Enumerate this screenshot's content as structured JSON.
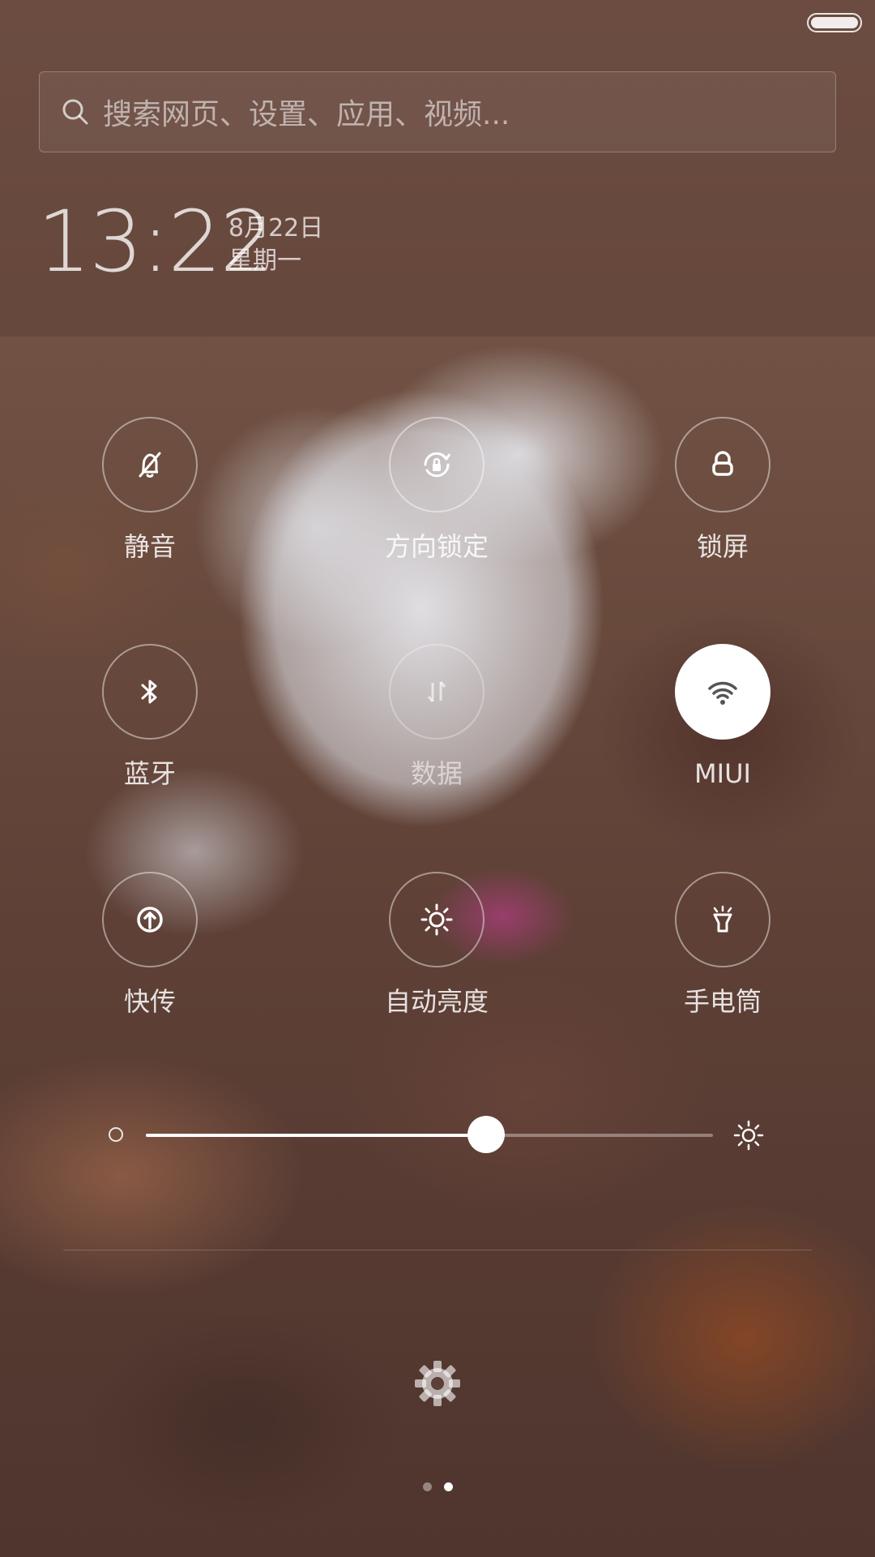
{
  "status_bar": {
    "battery_icon": "battery-full-icon"
  },
  "search": {
    "placeholder": "搜索网页、设置、应用、视频...",
    "icon": "search-icon"
  },
  "clock": {
    "time": "13:22",
    "date": "8月22日",
    "weekday": "星期一"
  },
  "toggles": [
    {
      "label": "静音",
      "icon": "bell-off-icon",
      "active": false
    },
    {
      "label": "方向锁定",
      "icon": "rotation-lock-icon",
      "active": false
    },
    {
      "label": "锁屏",
      "icon": "lock-icon",
      "active": false
    },
    {
      "label": "蓝牙",
      "icon": "bluetooth-icon",
      "active": false
    },
    {
      "label": "数据",
      "icon": "mobile-data-icon",
      "active": false,
      "disabled": true
    },
    {
      "label": "MIUI",
      "icon": "wifi-icon",
      "active": true
    },
    {
      "label": "快传",
      "icon": "transfer-icon",
      "active": false
    },
    {
      "label": "自动亮度",
      "icon": "auto-brightness-icon",
      "active": false
    },
    {
      "label": "手电筒",
      "icon": "flashlight-icon",
      "active": false
    }
  ],
  "brightness": {
    "level": 0.6,
    "min_icon": "brightness-low-icon",
    "max_icon": "brightness-high-icon"
  },
  "settings": {
    "icon": "gear-icon"
  },
  "pager": {
    "pages": 2,
    "current": 2
  },
  "colors": {
    "accent": "#ffffff",
    "tile_border": "rgba(255,255,255,0.45)"
  }
}
